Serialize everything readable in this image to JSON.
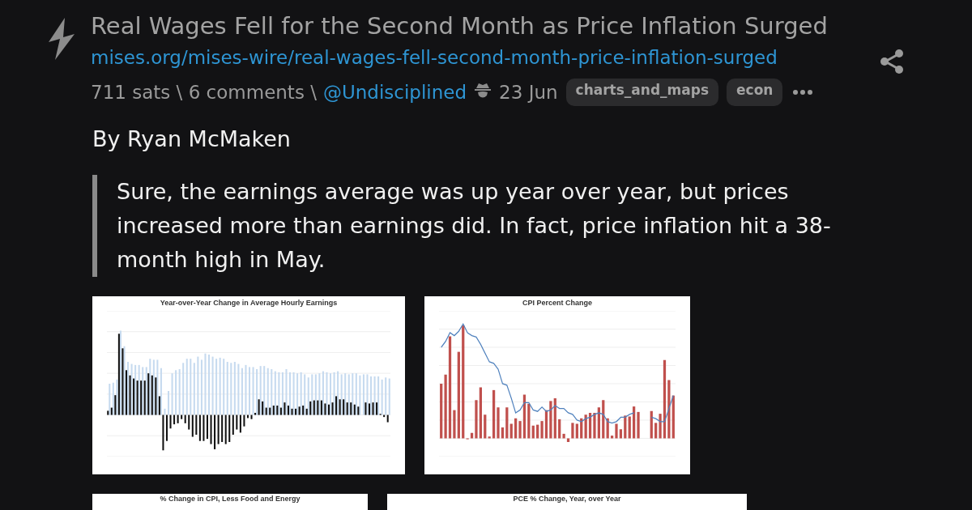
{
  "post": {
    "title": "Real Wages Fell for the Second Month as Price Inflation Surged",
    "url": "mises.org/mises-wire/real-wages-fell-second-month-price-inflation-surged",
    "stats": "711 sats \\ 6 comments \\",
    "author": "@Undisciplined",
    "date": "23 Jun",
    "tags": [
      "charts_and_maps",
      "econ"
    ]
  },
  "byline": "By Ryan McMaken",
  "quote": "Sure, the earnings average was up year over year, but prices increased more than earnings did. In fact, price inflation hit a 38-month high in May.",
  "images": [
    {
      "kind": "earnings",
      "title": "Year-over-Year Change in Average Hourly Earnings"
    },
    {
      "kind": "cpi",
      "title": "CPI Percent Change"
    },
    {
      "kind": "cropped",
      "title": "% Change in CPI, Less Food and Energy"
    },
    {
      "kind": "cropped",
      "title": "PCE % Change, Year, over Year"
    }
  ]
}
